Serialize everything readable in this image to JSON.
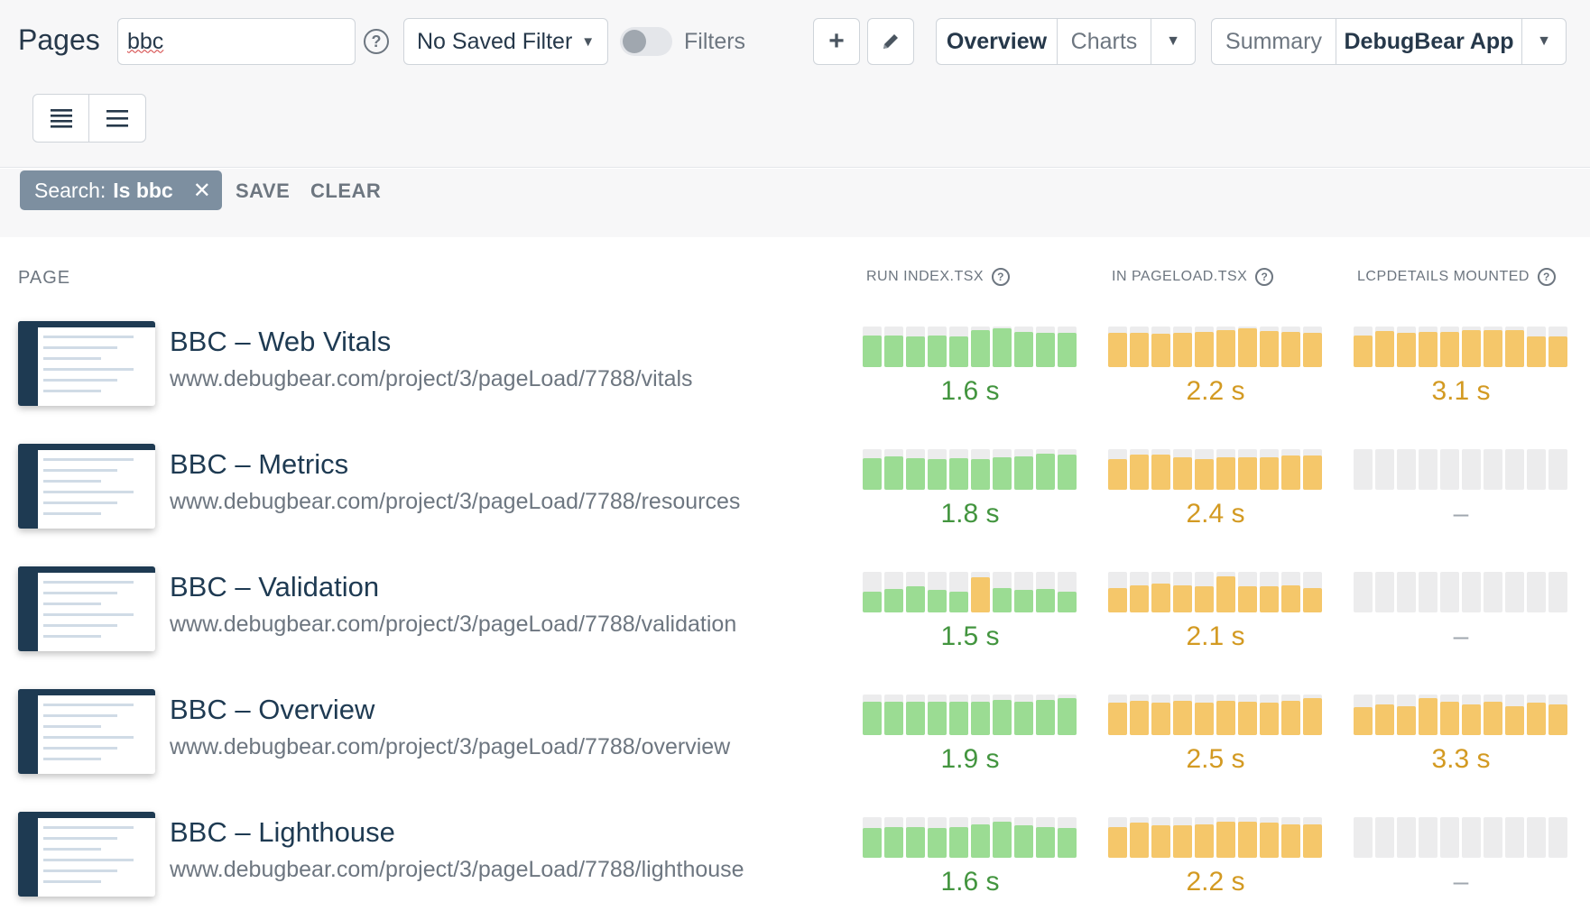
{
  "header": {
    "title": "Pages",
    "search_value": "bbc",
    "saved_filter": "No Saved Filter",
    "filters_label": "Filters",
    "view_tabs": [
      "Overview",
      "Charts"
    ],
    "dashboard_tabs": [
      "Summary",
      "DebugBear App"
    ]
  },
  "filter_chip": {
    "key": "Search:",
    "value": "Is bbc",
    "save_label": "SAVE",
    "clear_label": "CLEAR"
  },
  "columns": {
    "page": "PAGE",
    "metrics": [
      "RUN INDEX.TSX",
      "IN PAGELOAD.TSX",
      "LCPDETAILS MOUNTED"
    ]
  },
  "colors": {
    "green": "#9bdc93",
    "orange": "#f5c76a",
    "empty": "#ececed"
  },
  "rows": [
    {
      "title": "BBC – Web Vitals",
      "url": "www.debugbear.com/project/3/pageLoad/7788/vitals",
      "metrics": [
        {
          "value": "1.6 s",
          "status": "green",
          "bars": [
            0.78,
            0.78,
            0.76,
            0.78,
            0.76,
            0.9,
            0.95,
            0.86,
            0.84,
            0.84
          ],
          "bar_status": [
            "green",
            "green",
            "green",
            "green",
            "green",
            "green",
            "green",
            "green",
            "green",
            "green"
          ]
        },
        {
          "value": "2.2 s",
          "status": "orange",
          "bars": [
            0.85,
            0.85,
            0.83,
            0.85,
            0.86,
            0.9,
            0.95,
            0.89,
            0.86,
            0.85
          ],
          "bar_status": [
            "orange",
            "orange",
            "orange",
            "orange",
            "orange",
            "orange",
            "orange",
            "orange",
            "orange",
            "orange"
          ]
        },
        {
          "value": "3.1 s",
          "status": "orange",
          "bars": [
            0.78,
            0.88,
            0.84,
            0.86,
            0.86,
            0.9,
            0.92,
            0.9,
            0.76,
            0.76
          ],
          "bar_status": [
            "orange",
            "orange",
            "orange",
            "orange",
            "orange",
            "orange",
            "orange",
            "orange",
            "orange",
            "orange"
          ]
        }
      ]
    },
    {
      "title": "BBC – Metrics",
      "url": "www.debugbear.com/project/3/pageLoad/7788/resources",
      "metrics": [
        {
          "value": "1.8 s",
          "status": "green",
          "bars": [
            0.78,
            0.82,
            0.78,
            0.76,
            0.78,
            0.76,
            0.8,
            0.82,
            0.88,
            0.86
          ],
          "bar_status": [
            "green",
            "green",
            "green",
            "green",
            "green",
            "green",
            "green",
            "green",
            "green",
            "green"
          ]
        },
        {
          "value": "2.4 s",
          "status": "orange",
          "bars": [
            0.76,
            0.86,
            0.86,
            0.8,
            0.76,
            0.8,
            0.8,
            0.8,
            0.84,
            0.84
          ],
          "bar_status": [
            "orange",
            "orange",
            "orange",
            "orange",
            "orange",
            "orange",
            "orange",
            "orange",
            "orange",
            "orange"
          ]
        },
        {
          "value": "–",
          "status": "dash",
          "bars": [
            0,
            0,
            0,
            0,
            0,
            0,
            0,
            0,
            0,
            0
          ],
          "bar_status": [
            "empty",
            "empty",
            "empty",
            "empty",
            "empty",
            "empty",
            "empty",
            "empty",
            "empty",
            "empty"
          ]
        }
      ]
    },
    {
      "title": "BBC – Validation",
      "url": "www.debugbear.com/project/3/pageLoad/7788/validation",
      "metrics": [
        {
          "value": "1.5 s",
          "status": "green",
          "bars": [
            0.5,
            0.57,
            0.65,
            0.55,
            0.5,
            0.87,
            0.6,
            0.55,
            0.58,
            0.5
          ],
          "bar_status": [
            "green",
            "green",
            "green",
            "green",
            "green",
            "orange",
            "green",
            "green",
            "green",
            "green"
          ]
        },
        {
          "value": "2.1 s",
          "status": "orange",
          "bars": [
            0.6,
            0.67,
            0.72,
            0.67,
            0.65,
            0.88,
            0.65,
            0.65,
            0.67,
            0.6
          ],
          "bar_status": [
            "orange",
            "orange",
            "orange",
            "orange",
            "orange",
            "orange",
            "orange",
            "orange",
            "orange",
            "orange"
          ]
        },
        {
          "value": "–",
          "status": "dash",
          "bars": [
            0,
            0,
            0,
            0,
            0,
            0,
            0,
            0,
            0,
            0
          ],
          "bar_status": [
            "empty",
            "empty",
            "empty",
            "empty",
            "empty",
            "empty",
            "empty",
            "empty",
            "empty",
            "empty"
          ]
        }
      ]
    },
    {
      "title": "BBC – Overview",
      "url": "www.debugbear.com/project/3/pageLoad/7788/overview",
      "metrics": [
        {
          "value": "1.9 s",
          "status": "green",
          "bars": [
            0.83,
            0.83,
            0.83,
            0.83,
            0.83,
            0.83,
            0.86,
            0.83,
            0.86,
            0.9
          ],
          "bar_status": [
            "green",
            "green",
            "green",
            "green",
            "green",
            "green",
            "green",
            "green",
            "green",
            "green"
          ]
        },
        {
          "value": "2.5 s",
          "status": "orange",
          "bars": [
            0.8,
            0.84,
            0.8,
            0.84,
            0.8,
            0.84,
            0.82,
            0.8,
            0.85,
            0.9
          ],
          "bar_status": [
            "orange",
            "orange",
            "orange",
            "orange",
            "orange",
            "orange",
            "orange",
            "orange",
            "orange",
            "orange"
          ]
        },
        {
          "value": "3.3 s",
          "status": "orange",
          "bars": [
            0.7,
            0.76,
            0.72,
            0.9,
            0.82,
            0.76,
            0.82,
            0.72,
            0.8,
            0.76
          ],
          "bar_status": [
            "orange",
            "orange",
            "orange",
            "orange",
            "orange",
            "orange",
            "orange",
            "orange",
            "orange",
            "orange"
          ]
        }
      ]
    },
    {
      "title": "BBC – Lighthouse",
      "url": "www.debugbear.com/project/3/pageLoad/7788/lighthouse",
      "metrics": [
        {
          "value": "1.6 s",
          "status": "green",
          "bars": [
            0.73,
            0.76,
            0.76,
            0.73,
            0.76,
            0.83,
            0.88,
            0.8,
            0.76,
            0.73
          ],
          "bar_status": [
            "green",
            "green",
            "green",
            "green",
            "green",
            "green",
            "green",
            "green",
            "green",
            "green"
          ]
        },
        {
          "value": "2.2 s",
          "status": "orange",
          "bars": [
            0.76,
            0.86,
            0.8,
            0.8,
            0.83,
            0.88,
            0.88,
            0.86,
            0.82,
            0.82
          ],
          "bar_status": [
            "orange",
            "orange",
            "orange",
            "orange",
            "orange",
            "orange",
            "orange",
            "orange",
            "orange",
            "orange"
          ]
        },
        {
          "value": "–",
          "status": "dash",
          "bars": [
            0,
            0,
            0,
            0,
            0,
            0,
            0,
            0,
            0,
            0
          ],
          "bar_status": [
            "empty",
            "empty",
            "empty",
            "empty",
            "empty",
            "empty",
            "empty",
            "empty",
            "empty",
            "empty"
          ]
        }
      ]
    }
  ]
}
